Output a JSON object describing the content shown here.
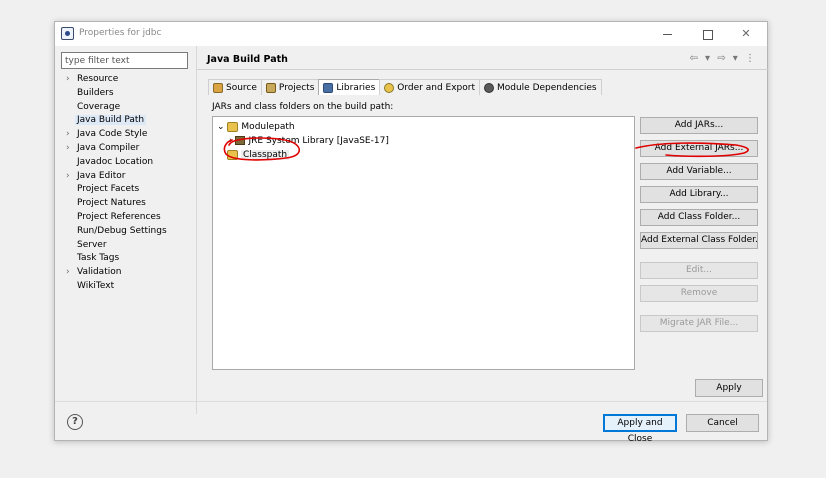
{
  "window": {
    "title": "Properties for jdbc",
    "controls": {
      "minimize": "",
      "maximize": "",
      "close": "✕"
    }
  },
  "filter": {
    "placeholder": "type filter text",
    "value": ""
  },
  "sidebar": {
    "items": [
      {
        "label": "Resource",
        "expandable": true
      },
      {
        "label": "Builders",
        "expandable": false
      },
      {
        "label": "Coverage",
        "expandable": false
      },
      {
        "label": "Java Build Path",
        "expandable": false,
        "selected": true
      },
      {
        "label": "Java Code Style",
        "expandable": true
      },
      {
        "label": "Java Compiler",
        "expandable": true
      },
      {
        "label": "Javadoc Location",
        "expandable": false
      },
      {
        "label": "Java Editor",
        "expandable": true
      },
      {
        "label": "Project Facets",
        "expandable": false
      },
      {
        "label": "Project Natures",
        "expandable": false
      },
      {
        "label": "Project References",
        "expandable": false
      },
      {
        "label": "Run/Debug Settings",
        "expandable": false
      },
      {
        "label": "Server",
        "expandable": false
      },
      {
        "label": "Task Tags",
        "expandable": false
      },
      {
        "label": "Validation",
        "expandable": true
      },
      {
        "label": "WikiText",
        "expandable": false
      }
    ]
  },
  "page": {
    "title": "Java Build Path",
    "nav": "⇦ ▾ ⇨ ▾ ⋮"
  },
  "tabs": [
    {
      "label": "Source",
      "icon": "source-folder-icon"
    },
    {
      "label": "Projects",
      "icon": "projects-icon"
    },
    {
      "label": "Libraries",
      "icon": "libraries-icon",
      "active": true
    },
    {
      "label": "Order and Export",
      "icon": "order-export-icon"
    },
    {
      "label": "Module Dependencies",
      "icon": "module-icon"
    }
  ],
  "libraries": {
    "heading": "JARs and class folders on the build path:",
    "tree": {
      "modulepath": {
        "label": "Modulepath",
        "toggle": "⌄"
      },
      "jre": {
        "label": "JRE System Library [JavaSE-17]",
        "toggle": "›"
      },
      "classpath": {
        "label": "Classpath"
      }
    },
    "buttons": {
      "add_jars": "Add JARs...",
      "add_external_jars": "Add External JARs...",
      "add_variable": "Add Variable...",
      "add_library": "Add Library...",
      "add_class_folder": "Add Class Folder...",
      "add_external_class_folder": "Add External Class Folder...",
      "edit": "Edit...",
      "remove": "Remove",
      "migrate_jar": "Migrate JAR File..."
    }
  },
  "footer": {
    "apply": "Apply",
    "help": "?",
    "apply_and_close": "Apply and Close",
    "cancel": "Cancel"
  },
  "colors": {
    "annotation": "#e00000",
    "focus": "#0078d7",
    "selection": "#dde9f7"
  }
}
